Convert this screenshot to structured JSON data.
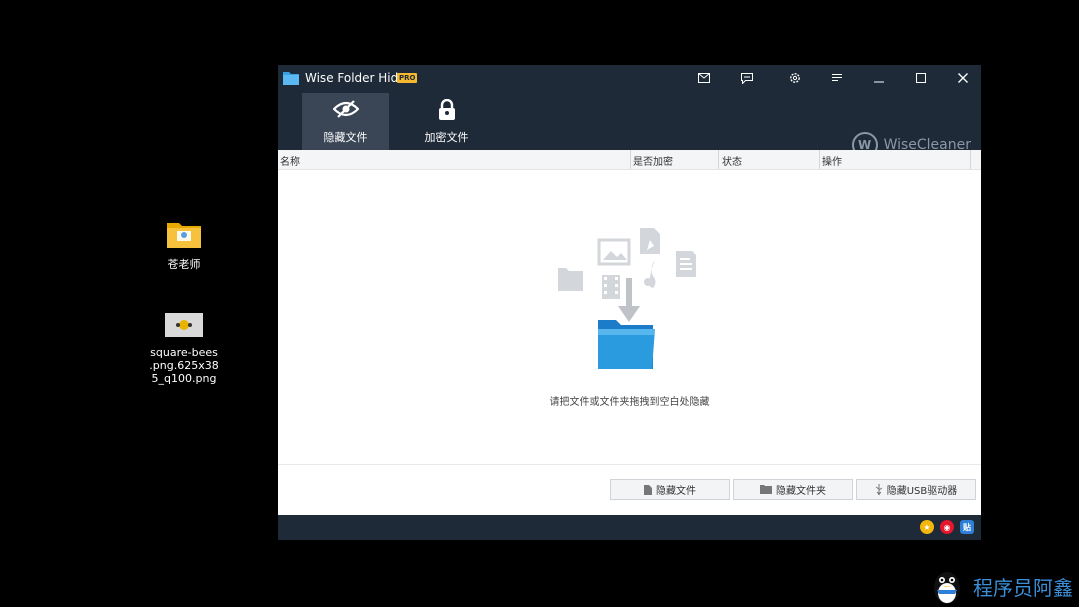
{
  "desktop": {
    "icons": [
      {
        "label": "苍老师"
      },
      {
        "label": "square-bees\n.png.625x38\n5_q100.png"
      }
    ]
  },
  "window": {
    "title": "Wise Folder Hider",
    "badge": "PRO",
    "toolbar": {
      "hide_files_label": "隐藏文件",
      "encrypt_files_label": "加密文件"
    },
    "brand": "WiseCleaner",
    "table": {
      "columns": [
        "名称",
        "是否加密",
        "状态",
        "操作"
      ]
    },
    "empty_hint": "请把文件或文件夹拖拽到空白处隐藏",
    "actions": {
      "hide_file": "隐藏文件",
      "hide_folder": "隐藏文件夹",
      "hide_usb": "隐藏USB驱动器"
    },
    "status_icons": [
      "star-icon",
      "weibo-icon",
      "tieba-icon"
    ],
    "status_tieba_text": "贴"
  },
  "watermark": {
    "text": "程序员阿鑫"
  },
  "colors": {
    "window_bg": "#1e2a38",
    "active_tab": "#3a4656",
    "folder_blue": "#2b9be0",
    "badge": "#f5b82e"
  }
}
